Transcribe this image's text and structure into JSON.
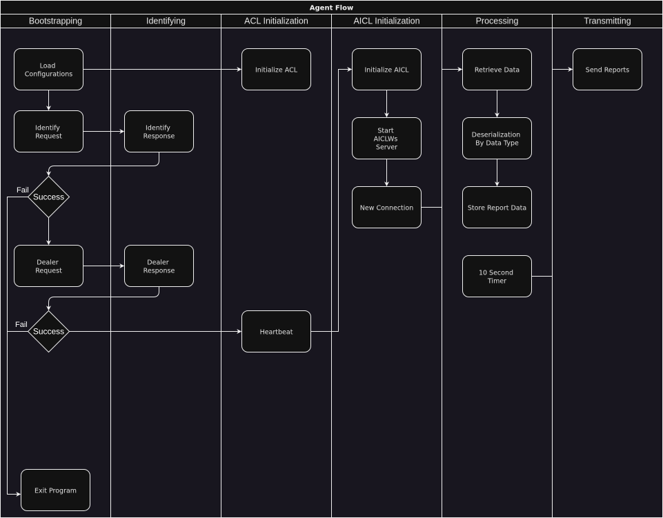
{
  "diagram": {
    "title": "Agent Flow",
    "colors": {
      "background": "#18161f",
      "header": "#121212",
      "stroke": "#f0f0f0",
      "node_fill": "#121212",
      "text": "#e0e0e0"
    },
    "lanes": [
      {
        "id": "bootstrapping",
        "label": "Bootstrapping"
      },
      {
        "id": "identifying",
        "label": "Identifying"
      },
      {
        "id": "acl-initialization",
        "label": "ACL Initialization"
      },
      {
        "id": "aicl-initialization",
        "label": "AICL Initialization"
      },
      {
        "id": "processing",
        "label": "Processing"
      },
      {
        "id": "transmitting",
        "label": "Transmitting"
      }
    ],
    "nodes": [
      {
        "id": "load-configurations",
        "type": "process",
        "lane": "bootstrapping",
        "lines": [
          "Load",
          "Configurations"
        ]
      },
      {
        "id": "identify-request",
        "type": "process",
        "lane": "bootstrapping",
        "lines": [
          "Identify",
          "Request"
        ]
      },
      {
        "id": "success-1",
        "type": "decision",
        "lane": "bootstrapping",
        "lines": [
          "Success"
        ]
      },
      {
        "id": "dealer-request",
        "type": "process",
        "lane": "bootstrapping",
        "lines": [
          "Dealer",
          "Request"
        ]
      },
      {
        "id": "success-2",
        "type": "decision",
        "lane": "bootstrapping",
        "lines": [
          "Success"
        ]
      },
      {
        "id": "exit-program",
        "type": "process",
        "lane": "bootstrapping",
        "lines": [
          "Exit Program"
        ]
      },
      {
        "id": "identify-response",
        "type": "process",
        "lane": "identifying",
        "lines": [
          "Identify",
          "Response"
        ]
      },
      {
        "id": "dealer-response",
        "type": "process",
        "lane": "identifying",
        "lines": [
          "Dealer",
          "Response"
        ]
      },
      {
        "id": "initialize-acl",
        "type": "process",
        "lane": "acl-initialization",
        "lines": [
          "Initialize ACL"
        ]
      },
      {
        "id": "heartbeat",
        "type": "process",
        "lane": "acl-initialization",
        "lines": [
          "Heartbeat"
        ]
      },
      {
        "id": "initialize-aicl",
        "type": "process",
        "lane": "aicl-initialization",
        "lines": [
          "Initialize AICL"
        ]
      },
      {
        "id": "start-aiclws-server",
        "type": "process",
        "lane": "aicl-initialization",
        "lines": [
          "Start",
          "AICLWs",
          "Server"
        ]
      },
      {
        "id": "new-connection",
        "type": "process",
        "lane": "aicl-initialization",
        "lines": [
          "New Connection"
        ]
      },
      {
        "id": "retrieve-data",
        "type": "process",
        "lane": "processing",
        "lines": [
          "Retrieve Data"
        ]
      },
      {
        "id": "deserialization-by-data-type",
        "type": "process",
        "lane": "processing",
        "lines": [
          "Deserialization",
          "By Data Type"
        ]
      },
      {
        "id": "store-report-data",
        "type": "process",
        "lane": "processing",
        "lines": [
          "Store Report Data"
        ]
      },
      {
        "id": "ten-second-timer",
        "type": "process",
        "lane": "processing",
        "lines": [
          "10 Second",
          "Timer"
        ]
      },
      {
        "id": "send-reports",
        "type": "process",
        "lane": "transmitting",
        "lines": [
          "Send Reports"
        ]
      }
    ],
    "edges": [
      {
        "from": "load-configurations",
        "to": "initialize-acl",
        "label": ""
      },
      {
        "from": "load-configurations",
        "to": "identify-request",
        "label": ""
      },
      {
        "from": "identify-request",
        "to": "identify-response",
        "label": ""
      },
      {
        "from": "identify-response",
        "to": "success-1",
        "label": ""
      },
      {
        "from": "success-1",
        "to": "dealer-request",
        "label": ""
      },
      {
        "from": "success-1",
        "to": "exit-program",
        "label": "Fail"
      },
      {
        "from": "dealer-request",
        "to": "dealer-response",
        "label": ""
      },
      {
        "from": "dealer-response",
        "to": "success-2",
        "label": ""
      },
      {
        "from": "success-2",
        "to": "heartbeat",
        "label": ""
      },
      {
        "from": "success-2",
        "to": "exit-program",
        "label": "Fail"
      },
      {
        "from": "heartbeat",
        "to": "initialize-aicl",
        "label": ""
      },
      {
        "from": "initialize-aicl",
        "to": "start-aiclws-server",
        "label": ""
      },
      {
        "from": "start-aiclws-server",
        "to": "new-connection",
        "label": ""
      },
      {
        "from": "new-connection",
        "to": "retrieve-data",
        "label": ""
      },
      {
        "from": "retrieve-data",
        "to": "deserialization-by-data-type",
        "label": ""
      },
      {
        "from": "deserialization-by-data-type",
        "to": "store-report-data",
        "label": ""
      },
      {
        "from": "ten-second-timer",
        "to": "send-reports",
        "label": ""
      }
    ]
  }
}
